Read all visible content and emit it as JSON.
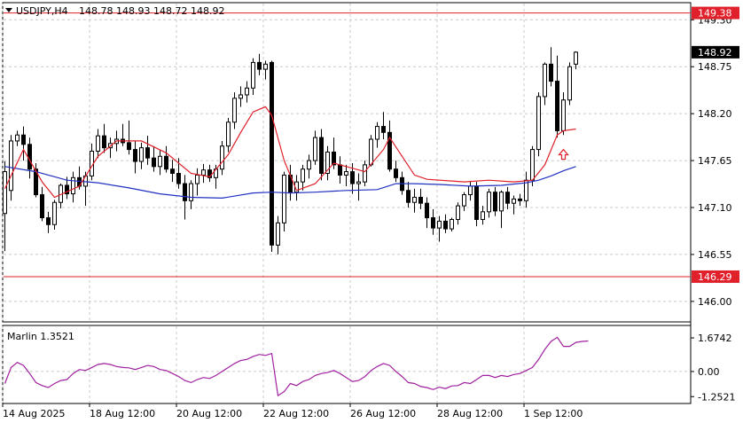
{
  "header": {
    "symbol": "USDJPY,H4",
    "ohlc": "148.78 148.93 148.72 148.92"
  },
  "colors": {
    "background": "#ffffff",
    "grid": "#c8c8c8",
    "candle_outline": "#000000",
    "bull_body": "#ffffff",
    "bear_body": "#000000",
    "ma_fast": "#e0202a",
    "ma_slow": "#2030c0",
    "levels": "#e0202a",
    "marlin": "#a020a0",
    "arrow": "#e0202a"
  },
  "indicator": {
    "label": "Marlin 1.3521"
  },
  "chart_data": [
    {
      "type": "candlestick",
      "title": "USDJPY,H4",
      "y_tick_labels": [
        "149.30",
        "148.75",
        "148.20",
        "147.65",
        "147.10",
        "146.55",
        "146.00"
      ],
      "ylim": [
        145.77,
        149.49
      ],
      "last_price": "148.92",
      "levels": [
        {
          "label": "149.38",
          "value": 149.38
        },
        {
          "label": "146.29",
          "value": 146.29
        }
      ],
      "x_tick_labels": [
        "14 Aug 2025",
        "18 Aug 12:00",
        "20 Aug 12:00",
        "22 Aug 12:00",
        "26 Aug 12:00",
        "28 Aug 12:00",
        "1 Sep 12:00"
      ],
      "candles": [
        [
          147.03,
          147.64,
          146.59,
          147.52
        ],
        [
          147.3,
          147.95,
          147.18,
          147.88
        ],
        [
          147.88,
          148.0,
          147.82,
          147.95
        ],
        [
          147.95,
          148.05,
          147.65,
          147.84
        ],
        [
          147.84,
          147.92,
          147.44,
          147.55
        ],
        [
          147.55,
          147.62,
          147.22,
          147.25
        ],
        [
          147.25,
          147.34,
          146.94,
          146.98
        ],
        [
          146.98,
          147.05,
          146.8,
          146.9
        ],
        [
          146.9,
          147.19,
          146.84,
          147.16
        ],
        [
          147.16,
          147.38,
          147.09,
          147.36
        ],
        [
          147.36,
          147.46,
          147.2,
          147.26
        ],
        [
          147.26,
          147.52,
          147.16,
          147.45
        ],
        [
          147.45,
          147.58,
          147.31,
          147.35
        ],
        [
          147.35,
          147.52,
          147.12,
          147.47
        ],
        [
          147.47,
          147.85,
          147.42,
          147.76
        ],
        [
          147.76,
          148.02,
          147.68,
          147.94
        ],
        [
          147.94,
          148.08,
          147.74,
          147.8
        ],
        [
          147.8,
          147.92,
          147.68,
          147.85
        ],
        [
          147.85,
          148.0,
          147.76,
          147.9
        ],
        [
          147.9,
          148.08,
          147.82,
          147.86
        ],
        [
          147.86,
          148.12,
          147.72,
          147.78
        ],
        [
          147.78,
          147.88,
          147.5,
          147.64
        ],
        [
          147.64,
          147.86,
          147.55,
          147.8
        ],
        [
          147.8,
          147.94,
          147.6,
          147.68
        ],
        [
          147.68,
          147.82,
          147.52,
          147.58
        ],
        [
          147.58,
          147.78,
          147.48,
          147.7
        ],
        [
          147.7,
          147.82,
          147.51,
          147.55
        ],
        [
          147.55,
          147.66,
          147.4,
          147.5
        ],
        [
          147.5,
          147.68,
          147.32,
          147.38
        ],
        [
          147.38,
          147.48,
          146.96,
          147.18
        ],
        [
          147.18,
          147.42,
          147.08,
          147.38
        ],
        [
          147.38,
          147.56,
          147.24,
          147.48
        ],
        [
          147.48,
          147.61,
          147.39,
          147.54
        ],
        [
          147.54,
          147.6,
          147.4,
          147.45
        ],
        [
          147.45,
          147.6,
          147.32,
          147.55
        ],
        [
          147.55,
          147.88,
          147.48,
          147.82
        ],
        [
          147.82,
          148.15,
          147.75,
          148.1
        ],
        [
          148.1,
          148.45,
          148.02,
          148.38
        ],
        [
          148.38,
          148.52,
          148.28,
          148.42
        ],
        [
          148.42,
          148.58,
          148.33,
          148.5
        ],
        [
          148.5,
          148.85,
          148.42,
          148.8
        ],
        [
          148.8,
          148.9,
          148.65,
          148.72
        ],
        [
          148.72,
          148.82,
          148.6,
          148.78
        ],
        [
          148.8,
          148.82,
          146.58,
          146.66
        ],
        [
          146.66,
          147.0,
          146.55,
          146.92
        ],
        [
          146.92,
          147.52,
          146.82,
          147.48
        ],
        [
          147.48,
          147.6,
          147.18,
          147.28
        ],
        [
          147.28,
          147.48,
          147.18,
          147.4
        ],
        [
          147.4,
          147.6,
          147.3,
          147.55
        ],
        [
          147.55,
          147.72,
          147.44,
          147.65
        ],
        [
          147.65,
          148.0,
          147.6,
          147.92
        ],
        [
          147.92,
          148.02,
          147.42,
          147.5
        ],
        [
          147.5,
          147.82,
          147.42,
          147.75
        ],
        [
          147.75,
          147.92,
          147.55,
          147.6
        ],
        [
          147.6,
          147.7,
          147.38,
          147.48
        ],
        [
          147.48,
          147.6,
          147.35,
          147.52
        ],
        [
          147.52,
          147.62,
          147.26,
          147.38
        ],
        [
          147.38,
          147.5,
          147.18,
          147.4
        ],
        [
          147.4,
          147.65,
          147.35,
          147.6
        ],
        [
          147.6,
          147.95,
          147.58,
          147.9
        ],
        [
          147.9,
          148.1,
          147.8,
          148.05
        ],
        [
          148.05,
          148.22,
          147.9,
          147.98
        ],
        [
          147.98,
          148.12,
          147.52,
          147.55
        ],
        [
          147.55,
          147.65,
          147.4,
          147.45
        ],
        [
          147.45,
          147.52,
          147.25,
          147.3
        ],
        [
          147.3,
          147.4,
          147.1,
          147.16
        ],
        [
          147.16,
          147.32,
          147.04,
          147.22
        ],
        [
          147.22,
          147.32,
          147.08,
          147.15
        ],
        [
          147.15,
          147.22,
          146.86,
          146.98
        ],
        [
          146.98,
          147.08,
          146.78,
          146.86
        ],
        [
          146.86,
          147.0,
          146.7,
          146.94
        ],
        [
          146.94,
          147.02,
          146.8,
          146.85
        ],
        [
          146.85,
          146.98,
          146.82,
          146.96
        ],
        [
          146.96,
          147.16,
          146.9,
          147.12
        ],
        [
          147.12,
          147.28,
          147.06,
          147.25
        ],
        [
          147.25,
          147.4,
          147.18,
          147.35
        ],
        [
          147.35,
          147.4,
          146.88,
          146.96
        ],
        [
          146.96,
          147.12,
          146.9,
          147.05
        ],
        [
          147.05,
          147.32,
          146.98,
          147.28
        ],
        [
          147.28,
          147.34,
          147.0,
          147.06
        ],
        [
          147.06,
          147.3,
          146.86,
          147.28
        ],
        [
          147.28,
          147.34,
          147.08,
          147.15
        ],
        [
          147.15,
          147.24,
          147.02,
          147.2
        ],
        [
          147.2,
          147.26,
          147.12,
          147.18
        ],
        [
          147.18,
          147.52,
          147.1,
          147.42
        ],
        [
          147.42,
          147.82,
          147.35,
          147.78
        ],
        [
          147.78,
          148.45,
          147.7,
          148.4
        ],
        [
          148.4,
          148.8,
          148.3,
          148.78
        ],
        [
          148.78,
          148.98,
          148.52,
          148.58
        ],
        [
          148.58,
          148.88,
          147.92,
          148.0
        ],
        [
          148.0,
          148.45,
          147.95,
          148.36
        ],
        [
          148.36,
          148.8,
          148.3,
          148.75
        ],
        [
          148.78,
          148.93,
          148.72,
          148.92
        ]
      ],
      "ma_fast": [
        [
          0,
          147.32
        ],
        [
          3,
          147.78
        ],
        [
          6,
          147.4
        ],
        [
          8,
          147.22
        ],
        [
          12,
          147.35
        ],
        [
          15,
          147.7
        ],
        [
          18,
          147.88
        ],
        [
          22,
          147.88
        ],
        [
          26,
          147.74
        ],
        [
          30,
          147.5
        ],
        [
          33,
          147.46
        ],
        [
          36,
          147.72
        ],
        [
          38,
          147.98
        ],
        [
          40,
          148.22
        ],
        [
          42,
          148.28
        ],
        [
          43,
          148.18
        ],
        [
          45,
          147.65
        ],
        [
          47,
          147.3
        ],
        [
          50,
          147.38
        ],
        [
          53,
          147.62
        ],
        [
          56,
          147.56
        ],
        [
          58,
          147.52
        ],
        [
          61,
          147.78
        ],
        [
          62,
          147.92
        ],
        [
          64,
          147.7
        ],
        [
          66,
          147.48
        ],
        [
          68,
          147.43
        ],
        [
          74,
          147.4
        ],
        [
          78,
          147.42
        ],
        [
          82,
          147.4
        ],
        [
          85,
          147.42
        ],
        [
          87,
          147.6
        ],
        [
          89,
          147.95
        ],
        [
          90,
          148.0
        ],
        [
          92,
          148.02
        ]
      ],
      "ma_slow": [
        [
          0,
          147.58
        ],
        [
          5,
          147.52
        ],
        [
          10,
          147.42
        ],
        [
          15,
          147.39
        ],
        [
          20,
          147.33
        ],
        [
          25,
          147.26
        ],
        [
          30,
          147.22
        ],
        [
          35,
          147.21
        ],
        [
          40,
          147.27
        ],
        [
          43,
          147.28
        ],
        [
          46,
          147.27
        ],
        [
          50,
          147.28
        ],
        [
          55,
          147.3
        ],
        [
          60,
          147.31
        ],
        [
          63,
          147.38
        ],
        [
          66,
          147.38
        ],
        [
          70,
          147.37
        ],
        [
          75,
          147.35
        ],
        [
          80,
          147.36
        ],
        [
          84,
          147.39
        ],
        [
          86,
          147.42
        ],
        [
          88,
          147.47
        ],
        [
          90,
          147.53
        ],
        [
          92,
          147.58
        ]
      ],
      "arrow_at": {
        "bar": 90,
        "price": 147.78
      }
    },
    {
      "type": "line",
      "title": "Marlin 1.3521",
      "y_tick_labels": [
        "1.6742",
        "0.00",
        "-1.2521"
      ],
      "ylim": [
        -1.55,
        2.25
      ],
      "series": [
        {
          "values": [
            -0.6,
            0.2,
            0.45,
            0.3,
            -0.1,
            -0.55,
            -0.7,
            -0.8,
            -0.6,
            -0.45,
            -0.4,
            -0.1,
            0.1,
            0.05,
            0.2,
            0.35,
            0.4,
            0.35,
            0.25,
            0.2,
            0.18,
            0.1,
            0.2,
            0.3,
            0.25,
            0.1,
            0.05,
            -0.1,
            -0.25,
            -0.45,
            -0.55,
            -0.4,
            -0.3,
            -0.35,
            -0.2,
            0.0,
            0.2,
            0.4,
            0.55,
            0.6,
            0.75,
            0.85,
            0.8,
            0.9,
            -1.2,
            -1.0,
            -0.6,
            -0.7,
            -0.5,
            -0.4,
            -0.2,
            -0.1,
            -0.05,
            0.05,
            -0.1,
            -0.3,
            -0.5,
            -0.45,
            -0.25,
            0.05,
            0.25,
            0.4,
            0.3,
            0.0,
            -0.25,
            -0.55,
            -0.6,
            -0.75,
            -0.8,
            -0.9,
            -0.78,
            -0.85,
            -0.72,
            -0.7,
            -0.55,
            -0.6,
            -0.4,
            -0.2,
            -0.2,
            -0.3,
            -0.2,
            -0.25,
            -0.15,
            -0.1,
            0.05,
            0.2,
            0.6,
            1.1,
            1.5,
            1.7,
            1.25,
            1.25,
            1.45,
            1.5,
            1.52
          ]
        }
      ]
    }
  ]
}
